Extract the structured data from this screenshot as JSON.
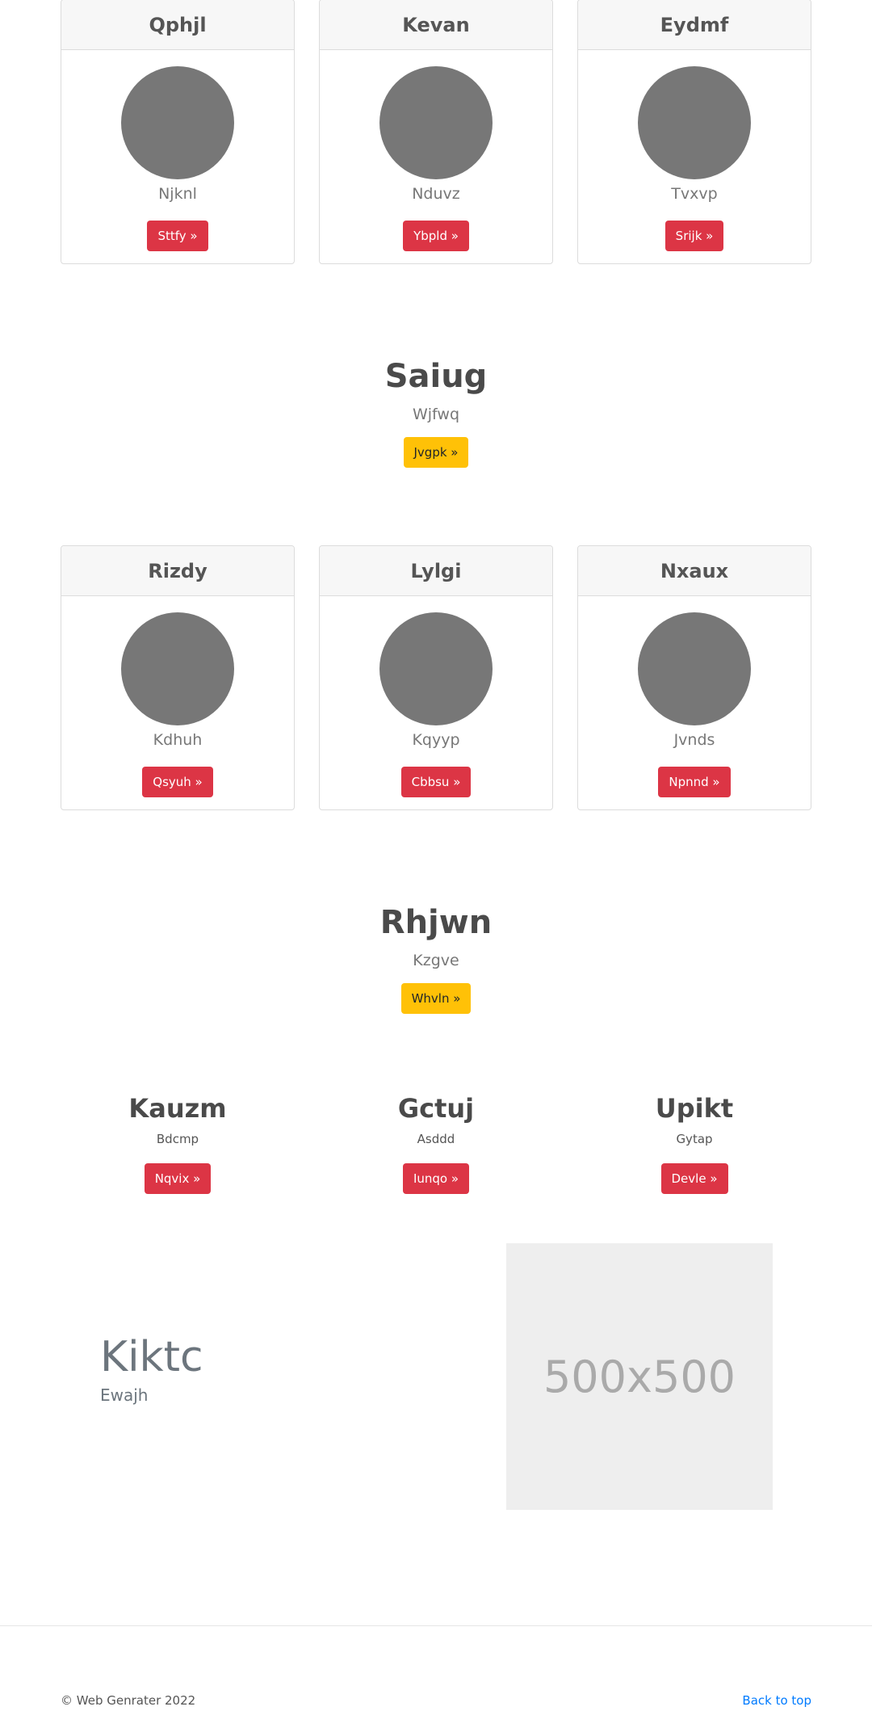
{
  "cards_row1": [
    {
      "title": "Qphjl",
      "subtitle": "Njknl",
      "button": "Sttfy »"
    },
    {
      "title": "Kevan",
      "subtitle": "Nduvz",
      "button": "Ybpld »"
    },
    {
      "title": "Eydmf",
      "subtitle": "Tvxvp",
      "button": "Srijk »"
    }
  ],
  "hero1": {
    "title": "Saiug",
    "subtitle": "Wjfwq",
    "button": "Jvgpk »"
  },
  "cards_row2": [
    {
      "title": "Rizdy",
      "subtitle": "Kdhuh",
      "button": "Qsyuh »"
    },
    {
      "title": "Lylgi",
      "subtitle": "Kqyyp",
      "button": "Cbbsu »"
    },
    {
      "title": "Nxaux",
      "subtitle": "Jvnds",
      "button": "Npnnd »"
    }
  ],
  "hero2": {
    "title": "Rhjwn",
    "subtitle": "Kzgve",
    "button": "Whvln »"
  },
  "features": [
    {
      "title": "Kauzm",
      "subtitle": "Bdcmp",
      "button": "Nqvix »"
    },
    {
      "title": "Gctuj",
      "subtitle": "Asddd",
      "button": "Iunqo »"
    },
    {
      "title": "Upikt",
      "subtitle": "Gytap",
      "button": "Devle »"
    }
  ],
  "promo": {
    "title": "Kiktc",
    "subtitle": "Ewajh",
    "placeholder": "500x500"
  },
  "footer": {
    "copyright": "© Web Genrater 2022",
    "back_to_top": "Back to top"
  },
  "colors": {
    "danger": "#dc3545",
    "warning": "#ffc107",
    "avatar": "#777777",
    "link": "#007bff"
  }
}
